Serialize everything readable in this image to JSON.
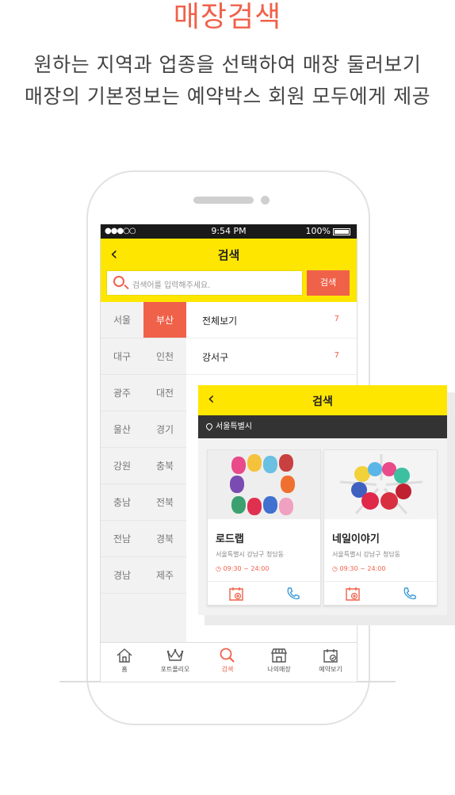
{
  "headline": {
    "title": "매장검색",
    "line1": "원하는 지역과 업종을 선택하여 매장 둘러보기",
    "line2": "매장의 기본정보는 예약박스 회원 모두에게 제공"
  },
  "statusbar": {
    "signal": "●●●○○",
    "time": "9:54 PM",
    "battery": "100%"
  },
  "appbar": {
    "back_icon": "chevron-left-icon",
    "title": "검색",
    "search_placeholder": "검색어를 입력해주세요.",
    "search_button": "검색"
  },
  "regions": [
    [
      "서울",
      "부산"
    ],
    [
      "대구",
      "인천"
    ],
    [
      "광주",
      "대전"
    ],
    [
      "울산",
      "경기"
    ],
    [
      "강원",
      "충북"
    ],
    [
      "충남",
      "전북"
    ],
    [
      "전남",
      "경북"
    ],
    [
      "경남",
      "제주"
    ]
  ],
  "selected_region": "부산",
  "districts": [
    {
      "name": "전체보기",
      "count": "7"
    },
    {
      "name": "강서구",
      "count": "7"
    }
  ],
  "tabs": [
    {
      "label": "홈",
      "icon": "home-icon"
    },
    {
      "label": "포트폴리오",
      "icon": "crown-icon"
    },
    {
      "label": "검색",
      "icon": "search-icon",
      "active": true
    },
    {
      "label": "나의매장",
      "icon": "store-icon"
    },
    {
      "label": "예약보기",
      "icon": "calendar-check-icon"
    }
  ],
  "overlay": {
    "title": "검색",
    "location": "서울특별시",
    "shops": [
      {
        "name": "로드랩",
        "address": "서울특별시 강남구 청담동",
        "hours": "09:30 ~ 24:00"
      },
      {
        "name": "네일이야기",
        "address": "서울특별시 강남구 청담동",
        "hours": "09:30 ~ 24:00"
      }
    ]
  },
  "colors": {
    "accent": "#f0614a",
    "yellow": "#ffe600",
    "dark": "#333333"
  }
}
